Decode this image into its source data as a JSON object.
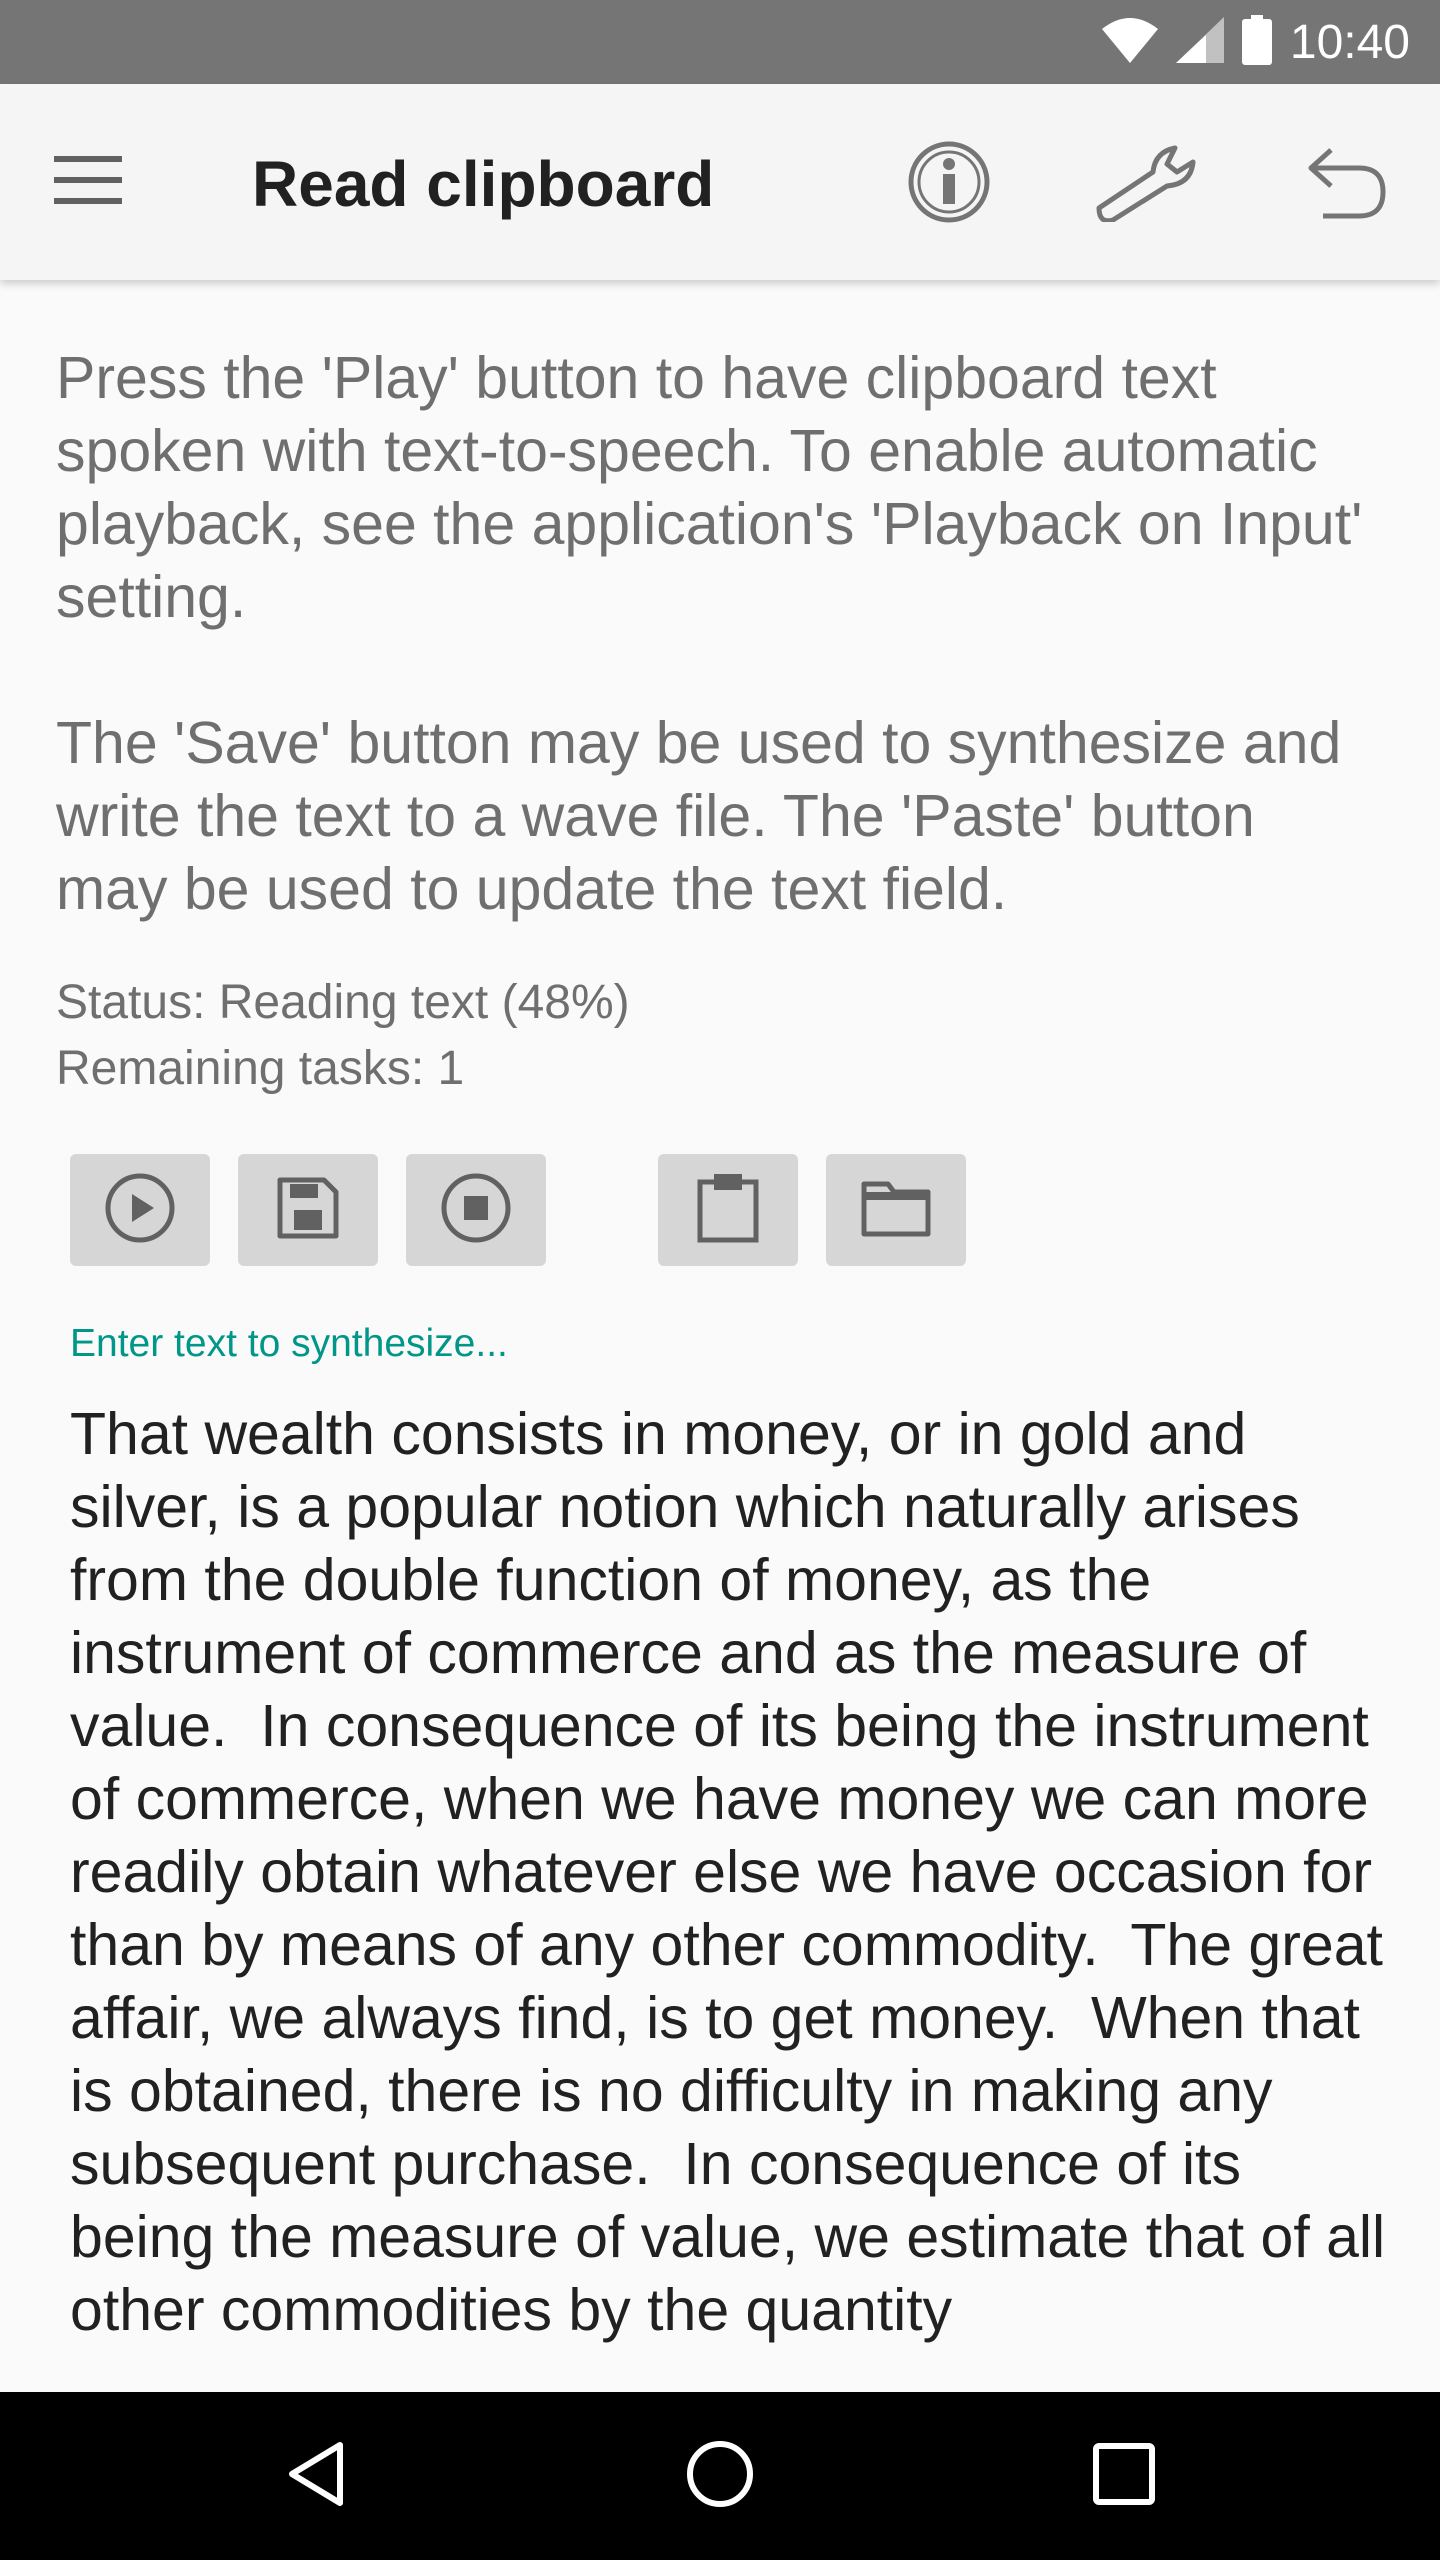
{
  "status_bar": {
    "time": "10:40",
    "icons": [
      "wifi-icon",
      "signal-icon",
      "battery-icon"
    ]
  },
  "app_bar": {
    "title": "Read clipboard",
    "menu_icon": "hamburger-menu-icon",
    "actions": [
      "info-icon",
      "wrench-icon",
      "undo-icon"
    ]
  },
  "instructions": {
    "paragraph1": "Press the 'Play' button to have clipboard text spoken with text-to-speech. To enable automatic playback, see the application's 'Playback on Input' setting.",
    "paragraph2": "The 'Save' button may be used to synthesize and write the text to a wave file. The 'Paste' button may be used to update the text field."
  },
  "status": {
    "status_text": "Status: Reading text (48%)",
    "progress_percent": 48,
    "remaining_tasks": "Remaining tasks: 1"
  },
  "toolbar": {
    "buttons": [
      "play-icon",
      "save-icon",
      "stop-icon",
      "paste-icon",
      "folder-icon"
    ]
  },
  "text_field": {
    "hint": "Enter text to synthesize...",
    "value": "That wealth consists in money, or in gold and silver, is a popular notion which naturally arises from the double function of money, as the instrument of commerce and as the measure of value.  In consequence of its being the instrument of commerce, when we have money we can more readily obtain whatever else we have occasion for than by means of any other commodity.  The great affair, we always find, is to get money.  When that is obtained, there is no difficulty in making any subsequent purchase.  In consequence of its being the measure of value, we estimate that of all other commodities by the quantity"
  },
  "nav_bar": {
    "buttons": [
      "back-icon",
      "home-icon",
      "recents-icon"
    ]
  },
  "colors": {
    "status_bar": "#757575",
    "app_bar": "#f5f5f5",
    "accent": "#009688",
    "button_bg": "#d6d6d6",
    "nav_bar": "#000000"
  }
}
